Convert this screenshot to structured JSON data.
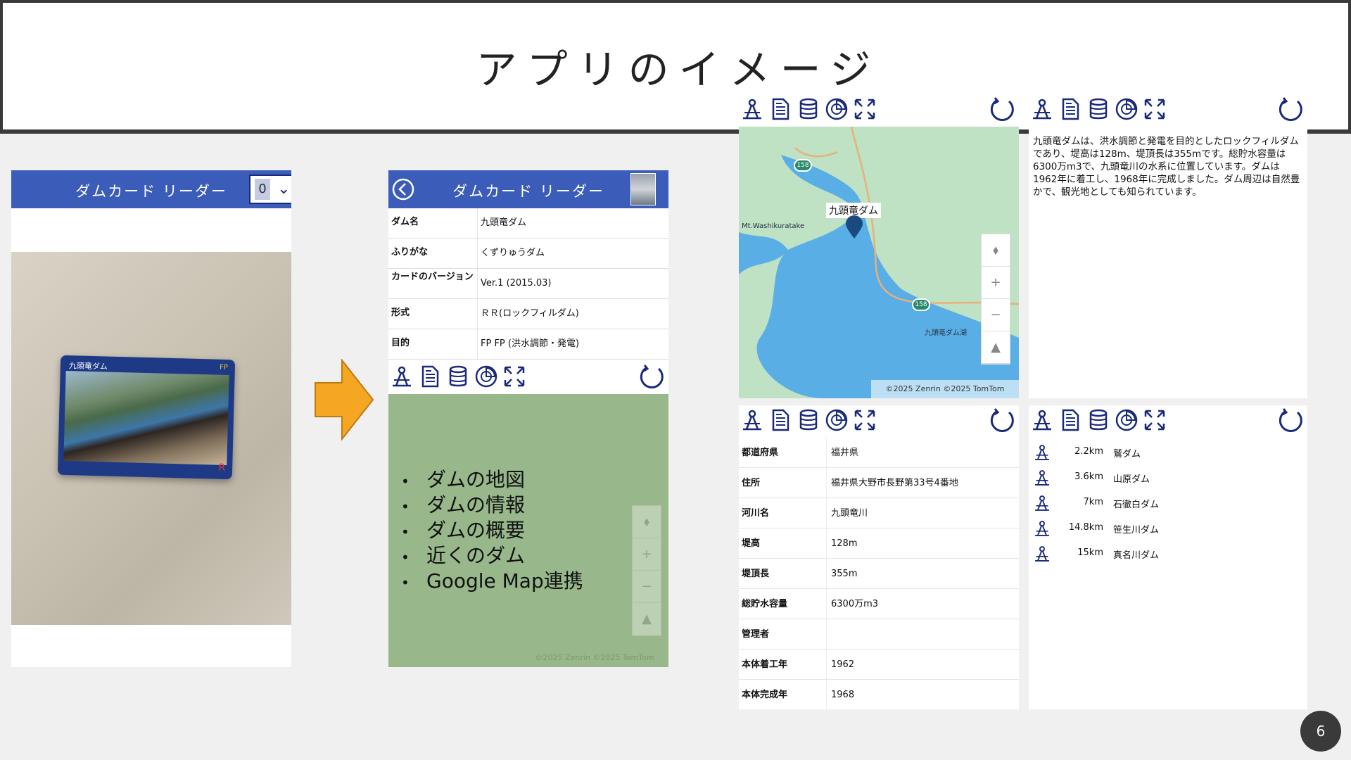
{
  "slide": {
    "title": "アプリのイメージ",
    "page_number": "6"
  },
  "reader_screen": {
    "app_title": "ダムカード リーダー",
    "select_value": "0",
    "card_title": "九頭竜ダム",
    "card_purpose": "FP",
    "card_type_mark": "R"
  },
  "detail_screen": {
    "app_title": "ダムカード リーダー",
    "rows": [
      {
        "label": "ダム名",
        "value": "九頭竜ダム"
      },
      {
        "label": "ふりがな",
        "value": "くずりゅうダム"
      },
      {
        "label": "カードのバージョン",
        "value": "Ver.1 (2015.03)"
      },
      {
        "label": "形式",
        "value": "ＲＲ(ロックフィルダム)"
      },
      {
        "label": "目的",
        "value": "FP FP (洪水調節・発電)"
      }
    ],
    "map_copyright": "©2025 Zenrin ©2025 TomTom",
    "features": [
      "ダムの地図",
      "ダムの情報",
      "ダムの概要",
      "近くのダム",
      "Google Map連携"
    ]
  },
  "map_screen": {
    "dam_label": "九頭竜ダム",
    "mountain_label": "Mt.Washikuratake",
    "route_label_1": "158",
    "route_label_2": "158",
    "lake_label": "九頭竜ダム湖",
    "copyright": "©2025 Zenrin ©2025 TomTom",
    "ctrl_compass": "⬧",
    "ctrl_zoom_in": "+",
    "ctrl_zoom_out": "−",
    "ctrl_tilt": "▲"
  },
  "summary_screen": {
    "description": "九頭竜ダムは、洪水調節と発電を目的としたロックフィルダムであり、堤高は128m、堤頂長は355mです。総貯水容量は6300万m3で、九頭竜川の水系に位置しています。ダムは1962年に着工し、1968年に完成しました。ダム周辺は自然豊かで、観光地としても知られています。"
  },
  "info_screen": {
    "rows": [
      {
        "label": "都道府県",
        "value": "福井県"
      },
      {
        "label": "住所",
        "value": "福井県大野市長野第33号4番地"
      },
      {
        "label": "河川名",
        "value": "九頭竜川"
      },
      {
        "label": "堤高",
        "value": "128m"
      },
      {
        "label": "堤頂長",
        "value": "355m"
      },
      {
        "label": "総貯水容量",
        "value": "6300万m3"
      },
      {
        "label": "管理者",
        "value": ""
      },
      {
        "label": "本体着工年",
        "value": "1962"
      },
      {
        "label": "本体完成年",
        "value": "1968"
      }
    ]
  },
  "nearby_screen": {
    "items": [
      {
        "distance": "2.2km",
        "name": "鷲ダム"
      },
      {
        "distance": "3.6km",
        "name": "山原ダム"
      },
      {
        "distance": "7km",
        "name": "石徹白ダム"
      },
      {
        "distance": "14.8km",
        "name": "笹生川ダム"
      },
      {
        "distance": "15km",
        "name": "真名川ダム"
      }
    ]
  },
  "icons": [
    "dam-map-icon",
    "document-icon",
    "database-icon",
    "pie-chart-icon",
    "expand-icon",
    "refresh-icon"
  ],
  "colors": {
    "appbar": "#3b5cb8",
    "icon": "#1a2a7a",
    "arrow": "#f5a623",
    "map_land": "#bfe1c4",
    "map_water": "#5aaee6"
  }
}
